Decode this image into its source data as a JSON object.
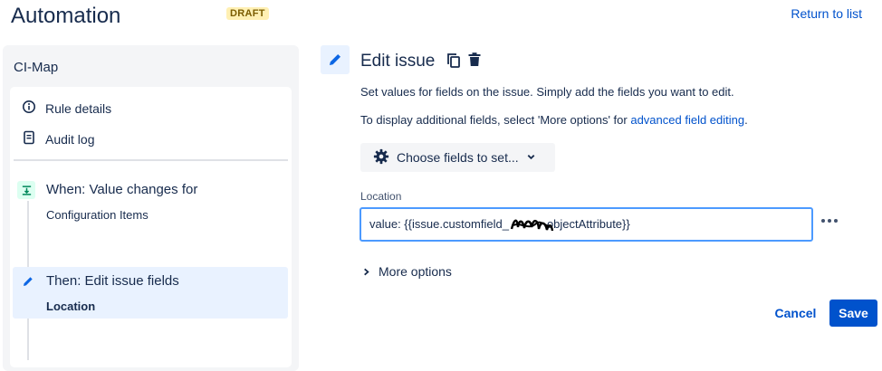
{
  "header": {
    "title": "Automation",
    "status_badge": "DRAFT",
    "return_link": "Return to list"
  },
  "sidebar": {
    "rule_name": "CI-Map",
    "nav": [
      {
        "label": "Rule details",
        "icon": "info-icon"
      },
      {
        "label": "Audit log",
        "icon": "document-icon"
      }
    ],
    "components": [
      {
        "title": "When: Value changes for",
        "subtitle": "Configuration Items",
        "icon": "trigger-icon"
      },
      {
        "title": "Then: Edit issue fields",
        "subtitle": "Location",
        "icon": "pencil-icon",
        "selected": true
      }
    ]
  },
  "editor": {
    "title": "Edit issue",
    "description": "Set values for fields on the issue. Simply add the fields you want to edit.",
    "additional_prefix": "To display additional fields, select 'More options' for ",
    "additional_link": "advanced field editing",
    "additional_suffix": ".",
    "choose_fields_label": "Choose fields to set...",
    "field": {
      "label": "Location",
      "value_prefix": "value: {{issue.customfield_",
      "value_suffix": "objectAttribute}}"
    },
    "more_options_label": "More options",
    "cancel_label": "Cancel",
    "save_label": "Save"
  },
  "colors": {
    "accent": "#0052cc",
    "selected_bg": "#e9f2ff",
    "draft_bg": "#fff0b3",
    "panel_bg": "#f4f5f7",
    "focus_border": "#4c9aff"
  }
}
